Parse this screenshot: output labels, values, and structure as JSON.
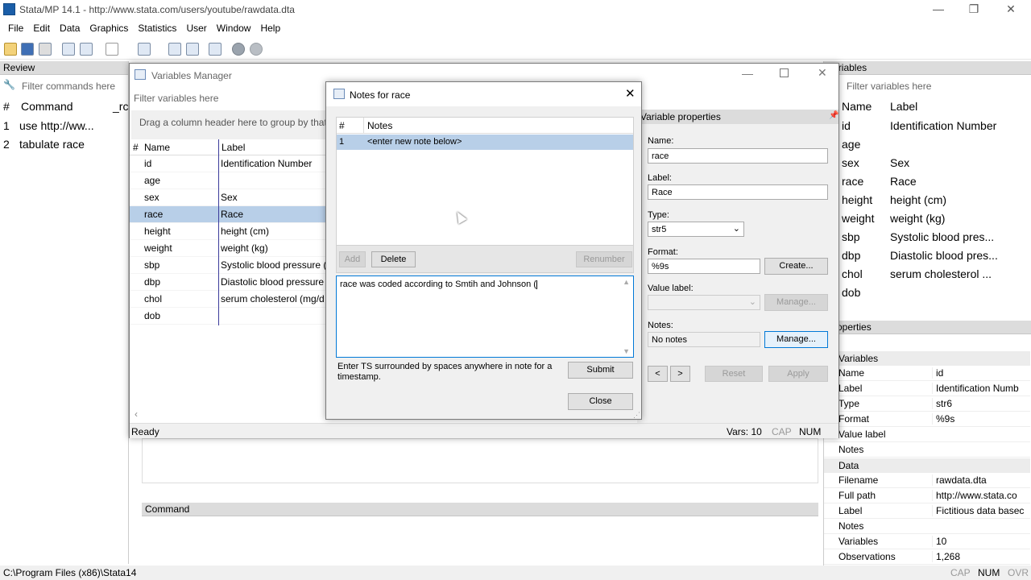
{
  "window": {
    "title": "Stata/MP 14.1 - http://www.stata.com/users/youtube/rawdata.dta",
    "minimize": "—",
    "maximize": "❐",
    "close": "✕"
  },
  "menu": [
    "File",
    "Edit",
    "Data",
    "Graphics",
    "Statistics",
    "User",
    "Window",
    "Help"
  ],
  "review": {
    "title": "Review",
    "filter_placeholder": "Filter commands here",
    "col_num": "#",
    "col_command": "Command",
    "col_rc": "_rc",
    "rows": [
      {
        "n": "1",
        "cmd": "use http://ww..."
      },
      {
        "n": "2",
        "cmd": "tabulate race"
      }
    ]
  },
  "varmgr": {
    "title": "Variables Manager",
    "filter_placeholder": "Filter variables here",
    "group_hint": "Drag a column header here to group by that",
    "col_num": "#",
    "col_name": "Name",
    "col_label": "Label",
    "rows": [
      {
        "name": "id",
        "label": "Identification Number"
      },
      {
        "name": "age",
        "label": ""
      },
      {
        "name": "sex",
        "label": "Sex"
      },
      {
        "name": "race",
        "label": "Race"
      },
      {
        "name": "height",
        "label": "height (cm)"
      },
      {
        "name": "weight",
        "label": "weight (kg)"
      },
      {
        "name": "sbp",
        "label": "Systolic blood pressure (r"
      },
      {
        "name": "dbp",
        "label": "Diastolic blood pressure ("
      },
      {
        "name": "chol",
        "label": "serum cholesterol (mg/d"
      },
      {
        "name": "dob",
        "label": ""
      }
    ],
    "selected": "race",
    "status": "Ready",
    "vars": "Vars: 10",
    "cap": "CAP",
    "num": "NUM",
    "props": {
      "title": "Variable properties",
      "name_label": "Name:",
      "name_value": "race",
      "label_label": "Label:",
      "label_value": "Race",
      "type_label": "Type:",
      "type_value": "str5",
      "format_label": "Format:",
      "format_value": "%9s",
      "create": "Create...",
      "valuelabel_label": "Value label:",
      "manage_disabled": "Manage...",
      "notes_label": "Notes:",
      "notes_value": "No notes",
      "manage": "Manage...",
      "prev": "<",
      "next": ">",
      "reset": "Reset",
      "apply": "Apply"
    }
  },
  "notes": {
    "title": "Notes for race",
    "col_num": "#",
    "col_notes": "Notes",
    "rows": [
      {
        "n": "1",
        "text": "<enter new note below>"
      }
    ],
    "add": "Add",
    "delete": "Delete",
    "renumber": "Renumber",
    "editor_text": "race was coded according to Smtih and Johnson (",
    "hint": "Enter TS surrounded by spaces anywhere in note for a timestamp.",
    "submit": "Submit",
    "close": "Close"
  },
  "variables": {
    "title": "Variables",
    "filter_placeholder": "Filter variables here",
    "col_name": "Name",
    "col_label": "Label",
    "rows": [
      {
        "name": "id",
        "label": "Identification Number"
      },
      {
        "name": "age",
        "label": ""
      },
      {
        "name": "sex",
        "label": "Sex"
      },
      {
        "name": "race",
        "label": "Race"
      },
      {
        "name": "height",
        "label": "height (cm)"
      },
      {
        "name": "weight",
        "label": "weight (kg)"
      },
      {
        "name": "sbp",
        "label": "Systolic blood pres..."
      },
      {
        "name": "dbp",
        "label": "Diastolic blood pres..."
      },
      {
        "name": "chol",
        "label": "serum cholesterol ..."
      },
      {
        "name": "dob",
        "label": ""
      }
    ]
  },
  "properties": {
    "title": "Properties",
    "sec_variables": "Variables",
    "sec_data": "Data",
    "var_rows": [
      {
        "k": "Name",
        "v": "id"
      },
      {
        "k": "Label",
        "v": "Identification Numb"
      },
      {
        "k": "Type",
        "v": "str6"
      },
      {
        "k": "Format",
        "v": "%9s"
      },
      {
        "k": "Value label",
        "v": ""
      },
      {
        "k": "Notes",
        "v": ""
      }
    ],
    "data_rows": [
      {
        "k": "Filename",
        "v": "rawdata.dta"
      },
      {
        "k": "Full path",
        "v": "http://www.stata.co"
      },
      {
        "k": "Label",
        "v": "Fictitious data basec"
      },
      {
        "k": "Notes",
        "v": ""
      },
      {
        "k": "Variables",
        "v": "10"
      },
      {
        "k": "Observations",
        "v": "1,268"
      }
    ]
  },
  "command": {
    "title": "Command"
  },
  "status": {
    "path": "C:\\Program Files (x86)\\Stata14",
    "cap": "CAP",
    "num": "NUM",
    "ovr": "OVR"
  },
  "colors": {
    "selection": "#b8cfe8",
    "accent": "#0078d7",
    "panel": "#dcdcdc"
  }
}
